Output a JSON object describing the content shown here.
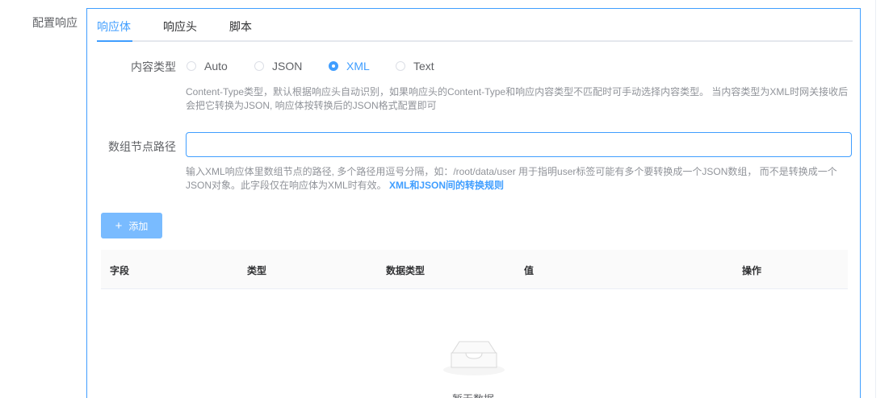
{
  "form": {
    "label": "配置响应"
  },
  "tabs": [
    {
      "label": "响应体",
      "active": true
    },
    {
      "label": "响应头",
      "active": false
    },
    {
      "label": "脚本",
      "active": false
    }
  ],
  "content_type": {
    "label": "内容类型",
    "options": [
      "Auto",
      "JSON",
      "XML",
      "Text"
    ],
    "selected": "XML",
    "help": "Content-Type类型，默认根据响应头自动识别，如果响应头的Content-Type和响应内容类型不匹配时可手动选择内容类型。 当内容类型为XML时网关接收后会把它转换为JSON, 响应体按转换后的JSON格式配置即可"
  },
  "array_path": {
    "label": "数组节点路径",
    "value": "",
    "placeholder": "",
    "help": "输入XML响应体里数组节点的路径, 多个路径用逗号分隔，如：/root/data/user 用于指明user标签可能有多个要转换成一个JSON数组， 而不是转换成一个JSON对象。此字段仅在响应体为XML时有效。",
    "help_link": "XML和JSON间的转换规则"
  },
  "add_button": {
    "icon": "plus-icon",
    "label": "添加"
  },
  "table": {
    "columns": [
      "字段",
      "类型",
      "数据类型",
      "值",
      "操作"
    ],
    "rows": [],
    "empty_text": "暂无数据",
    "empty_icon": "empty-box-icon"
  },
  "colors": {
    "accent": "#409eff",
    "button_disabled": "#79bbff",
    "muted_text": "#909399"
  }
}
